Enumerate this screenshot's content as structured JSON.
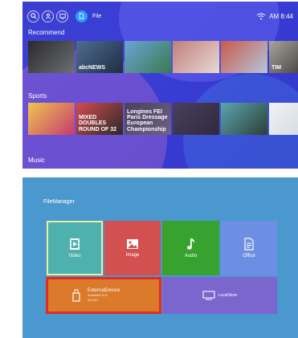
{
  "top_screen": {
    "status": {
      "file_label": "File",
      "time": "AM 8:44"
    },
    "rows": [
      {
        "title": "Recommend",
        "items": [
          {
            "caption": "",
            "colors": [
              "#2b2a2a",
              "#6b6f74"
            ]
          },
          {
            "caption": "abcNEWS",
            "colors": [
              "#4f6d8f",
              "#1e2d45"
            ]
          },
          {
            "caption": "",
            "colors": [
              "#6aa4d9",
              "#3b7a4d"
            ]
          },
          {
            "caption": "",
            "colors": [
              "#c27e7c",
              "#e6dad2"
            ]
          },
          {
            "caption": "",
            "colors": [
              "#c95a4a",
              "#b3c6dc"
            ]
          },
          {
            "caption": "TIM",
            "colors": [
              "#a8a39d",
              "#34312d"
            ]
          }
        ]
      },
      {
        "title": "Sports",
        "items": [
          {
            "caption": "",
            "colors": [
              "#f0c44f",
              "#c53a6e"
            ]
          },
          {
            "caption": "MIXED DOUBLES ROUND OF 32",
            "colors": [
              "#d44b50",
              "#2a2a2a"
            ]
          },
          {
            "caption": "Longines FEI Paris Dressage European Championship",
            "colors": [
              "#4a3f5e",
              "#6e6284"
            ]
          },
          {
            "caption": "",
            "colors": [
              "#4a3f5e",
              "#2f2a3c"
            ]
          },
          {
            "caption": "",
            "colors": [
              "#5aa5b0",
              "#2d3f34"
            ]
          },
          {
            "caption": "",
            "colors": [
              "#f2f2f2",
              "#cfd7e3"
            ]
          }
        ]
      },
      {
        "title": "Music",
        "items": []
      }
    ]
  },
  "bottom_screen": {
    "title": "FileManager",
    "tiles": {
      "video": "Video",
      "image": "Image",
      "audio": "Audio",
      "office": "Office",
      "external": {
        "name": "ExternalDevice",
        "available": "Available:31G",
        "total": "All:64G"
      },
      "local": "LocalStore"
    }
  },
  "icons": [
    "search-icon",
    "user-icon",
    "tv-icon",
    "file-icon",
    "wifi-icon",
    "film-icon",
    "image-icon",
    "music-note-icon",
    "document-icon",
    "usb-drive-icon",
    "monitor-icon"
  ]
}
